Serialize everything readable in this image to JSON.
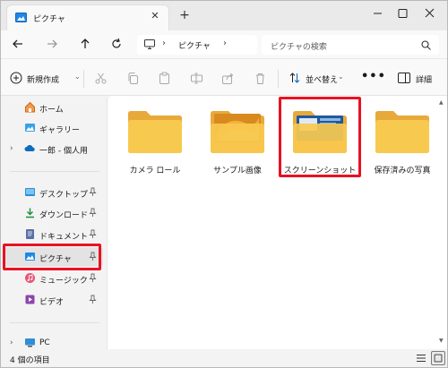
{
  "window": {
    "tab_title": "ピクチャ",
    "new_tab_symbol": "+",
    "close_symbol": "✕"
  },
  "address_bar": {
    "breadcrumb": "ピクチャ",
    "separator": "›",
    "search_placeholder": "ピクチャの検索"
  },
  "command_bar": {
    "new_label": "新規作成",
    "sort_label": "並べ替え",
    "more_label": "•••",
    "details_label": "詳細",
    "caret": "⌄"
  },
  "sidebar": {
    "chevron": "›",
    "items": [
      {
        "label": "ホーム",
        "icon": "home-icon"
      },
      {
        "label": "ギャラリー",
        "icon": "gallery-icon"
      },
      {
        "label": "一郎 - 個人用",
        "icon": "onedrive-icon"
      },
      {
        "label": "デスクトップ",
        "icon": "desktop-icon"
      },
      {
        "label": "ダウンロード",
        "icon": "download-icon"
      },
      {
        "label": "ドキュメント",
        "icon": "documents-icon"
      },
      {
        "label": "ピクチャ",
        "icon": "pictures-icon"
      },
      {
        "label": "ミュージック",
        "icon": "music-icon"
      },
      {
        "label": "ビデオ",
        "icon": "videos-icon"
      },
      {
        "label": "PC",
        "icon": "pc-icon"
      }
    ]
  },
  "folders": [
    {
      "label": "カメラ ロール",
      "icon": "folder-icon"
    },
    {
      "label": "サンプル画像",
      "icon": "folder-image-icon"
    },
    {
      "label": "スクリーンショット",
      "icon": "folder-screenshot-icon"
    },
    {
      "label": "保存済みの写真",
      "icon": "folder-icon"
    }
  ],
  "status": {
    "item_count": "4 個の項目"
  },
  "colors": {
    "highlight": "#e81123",
    "accent": "#0067c0",
    "folder": "#f8c94f",
    "folder_back": "#e8a93b"
  }
}
